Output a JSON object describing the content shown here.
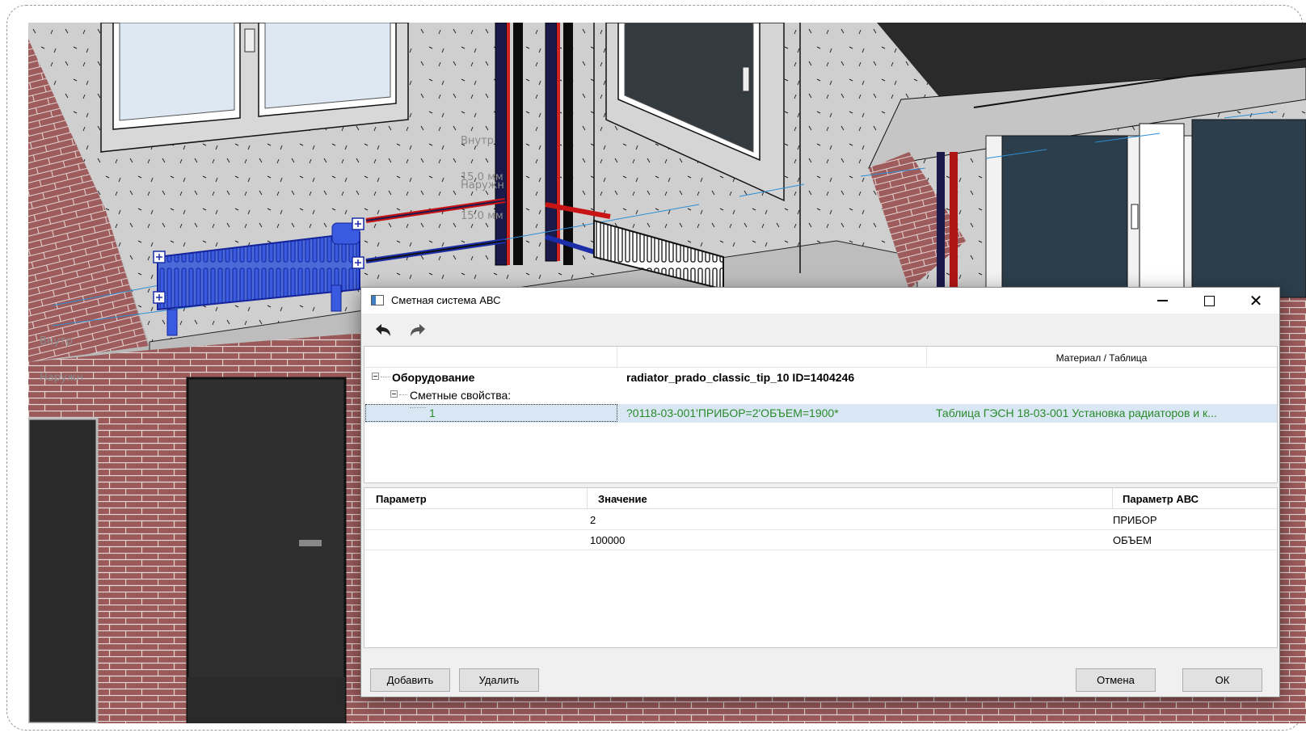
{
  "scene": {
    "annotations": [
      "Внутр",
      "15.0 мм",
      "Наружн",
      "15.0 мм",
      "Внутр",
      "Наружн"
    ]
  },
  "dialog": {
    "title": "Сметная система АВС",
    "icons": {
      "app": "window-app-icon",
      "undo": "undo-icon",
      "redo": "redo-icon"
    },
    "tree": {
      "header_material": "Материал / Таблица",
      "equipment_label": "Оборудование",
      "equipment_value": "radiator_prado_classic_tip_10  ID=1404246",
      "estimate_props_label": "Сметные свойства:",
      "selected_row": {
        "index": "1",
        "formula": "?0118-03-001'ПРИБОР=2'ОБЪЕМ=1900*",
        "table": "Таблица ГЭСН 18-03-001 Установка радиаторов и к..."
      }
    },
    "grid": {
      "headers": [
        "Параметр",
        "Значение",
        "Параметр АВС"
      ],
      "rows": [
        {
          "param": "",
          "value": "2",
          "abc_param": "ПРИБОР"
        },
        {
          "param": "",
          "value": "100000",
          "abc_param": "ОБЪЕМ"
        }
      ]
    },
    "buttons": {
      "add": "Добавить",
      "delete": "Удалить",
      "cancel": "Отмена",
      "ok": "ОК"
    }
  }
}
